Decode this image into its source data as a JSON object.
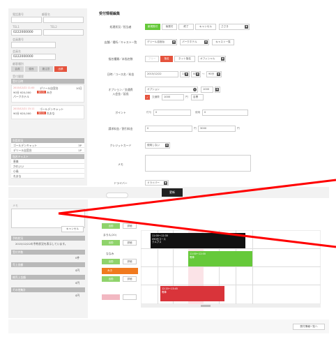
{
  "form": {
    "title": "受付情報編集",
    "status_label": "処理状況／担当者",
    "status_buttons": [
      "新規受付",
      "後受付",
      "終了",
      "キャンセル"
    ],
    "staff_select": "ささき",
    "location_label": "店舗／場所／キャスト一覧",
    "store_select": "デリール自宮台",
    "area_select": "パークホテル",
    "cast_list_btn": "キャスト一覧",
    "nomination_label": "指名種類／本指名数",
    "nom_buttons": [
      "フリー",
      "指名",
      "ネット指名",
      "オフィシャル"
    ],
    "datetime_label": "日時／コース名／料金",
    "date": "2015/12/22",
    "hour": "11",
    "minute": "00",
    "sep": "～",
    "course": "90分",
    "option_label_1": "オプション／交通費",
    "option_label_2": "入会金／延長",
    "option_select": "オプション",
    "option_price": "1000",
    "transport_checkbox_label": "交通費",
    "transport_price": "1000",
    "transport_unit": "円",
    "area_extra": "目黒",
    "point_label": "ポイント",
    "point_prefix": "付与",
    "point_value": "0",
    "point_use": "使用",
    "point_use_value": "0",
    "fee_label": "請求料金／割引料金",
    "fee_value": "0",
    "fee_unit": "円",
    "discount_value": "3000",
    "discount_unit": "円",
    "card_label": "クレジットカード",
    "card_select": "使用しない",
    "memo_label": "メモ",
    "driver_label": "ドライバー",
    "driver_select": "ドライバー",
    "update_btn": "更新"
  },
  "left": {
    "tel_label": "電話番号",
    "name_label": "顧客名",
    "tel_label2": "TEL1",
    "tel_label3": "TEL2",
    "tel_value": "0222000000",
    "member_label": "会員番号",
    "member_label2": "会員名",
    "member_value": "0222000000",
    "rank_label": "顧客種別",
    "rank_buttons": [
      "会員",
      "優良",
      "要注意",
      "出禁"
    ],
    "history_label": "受付履歴",
    "history_head": "受付日時",
    "history_count": "10日",
    "history": [
      {
        "date": "2015/12/22 11:00",
        "store": "デリール自宮台",
        "status": "受付済",
        "cast": "みき",
        "place": "パークホテル",
        "price": "90分 ¥20,000"
      },
      {
        "date": "2015/12/21 15:11",
        "store": "ゴールデンキャット",
        "status": "受付済",
        "cast": "れおな",
        "place": "",
        "price": "90分 ¥20,000"
      }
    ],
    "stats_label": "利用状況",
    "stats": [
      {
        "name": "ゴールデンキャット",
        "value": "3P"
      },
      {
        "name": "デリール自宮台",
        "value": "1P"
      }
    ],
    "cast_label": "指名キャスト",
    "casts": [
      "恵美",
      "かれいい",
      "小鳥",
      "れおな"
    ]
  },
  "lower": {
    "memo_label": "メモ",
    "cancel_btn": "キャンセル",
    "reserve_label": "予約状況",
    "reserve_text": "2015/12/22の予約状況を表示しています。",
    "count_label": "受付件数",
    "count_value": "0件",
    "sales_label": "売上金額",
    "sales_value": "0円",
    "total_label": "総売上金額",
    "total_value": "0円",
    "misc_label": "その他集計",
    "misc_value": "0円",
    "casts": [
      {
        "name": "まろん(20)",
        "tag": "出勤",
        "detail": "詳細"
      },
      {
        "name": "めい",
        "tag": "出勤",
        "detail": "詳細"
      },
      {
        "name": "ななみ",
        "tag": "出勤",
        "detail": "詳細"
      },
      {
        "name": "みき",
        "tag": "出勤",
        "detail": "詳細"
      }
    ],
    "blocks": [
      {
        "line1": "11:00～12:30",
        "line2": "090分コース",
        "line3": "クルプス"
      },
      {
        "line1": "11:00～12:00",
        "line2": "電車"
      },
      {
        "line1": "12:20～13:45",
        "line2": "電車"
      }
    ],
    "list_btn": "受付情報一覧へ"
  },
  "colors": {
    "accent_green": "#66c93a",
    "accent_red": "#e5533d",
    "pink": "#f2b8c2",
    "dark": "#222222",
    "line_red": "#ff0000"
  }
}
